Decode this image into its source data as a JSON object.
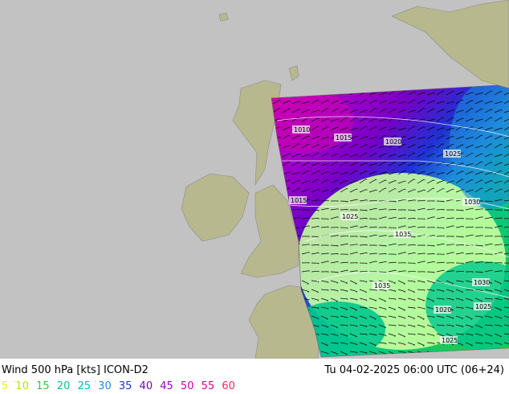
{
  "footer": {
    "title": "Wind 500 hPa [kts] ICON-D2",
    "datetime": "Tu 04-02-2025 06:00 UTC (06+24)"
  },
  "legend": [
    {
      "label": "5",
      "color": "#f0f000"
    },
    {
      "label": "10",
      "color": "#b4e600"
    },
    {
      "label": "15",
      "color": "#32c832"
    },
    {
      "label": "20",
      "color": "#00c88c"
    },
    {
      "label": "25",
      "color": "#00bebe"
    },
    {
      "label": "30",
      "color": "#1e8cdc"
    },
    {
      "label": "35",
      "color": "#1e32d2"
    },
    {
      "label": "40",
      "color": "#7800c8"
    },
    {
      "label": "45",
      "color": "#a000c8"
    },
    {
      "label": "50",
      "color": "#c800b4"
    },
    {
      "label": "55",
      "color": "#e6008c"
    },
    {
      "label": "60",
      "color": "#f0285a"
    }
  ],
  "isobars": [
    {
      "label": "1010"
    },
    {
      "label": "1015"
    },
    {
      "label": "1020"
    },
    {
      "label": "1025"
    },
    {
      "label": "1015"
    },
    {
      "label": "1030"
    },
    {
      "label": "1025"
    },
    {
      "label": "1035"
    },
    {
      "label": "1030"
    },
    {
      "label": "1035"
    },
    {
      "label": "1025"
    },
    {
      "label": "1020"
    },
    {
      "label": "1025"
    }
  ]
}
